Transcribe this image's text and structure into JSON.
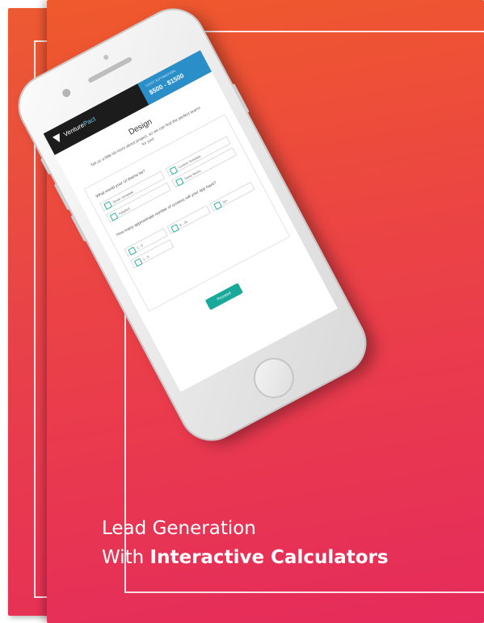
{
  "colors": {
    "cover_top": "#ef5a2c",
    "cover_bottom": "#e52b5c",
    "teal": "#19a99a",
    "blue": "#2a8fc9"
  },
  "cover": {
    "title_line1": "Lead Generation",
    "title_line2_prefix": "With",
    "title_line2_bold": "Interactive Calculators"
  },
  "phone": {
    "icons": {
      "logo": "venturepact-logo-icon",
      "home": "home-button-icon"
    },
    "brand_prefix": "Venture",
    "brand_suffix": "Pact",
    "price_label": "Cost estimation",
    "price_value": "$500 - $1500",
    "screen_title": "Design",
    "screen_subtitle": "Tell us a little bit more about project, so we can find the perfect teams for you!",
    "question1": "What would your UI theme be?",
    "options1": [
      "Stock / template",
      "Custom Template",
      "Adapted",
      "Same theme"
    ],
    "question2": "How many approximate number of screens will your app have?",
    "options2": [
      "1 - 5",
      "6 - 15",
      "16+",
      "1 - 5"
    ],
    "proceed_label": "Proceed"
  }
}
